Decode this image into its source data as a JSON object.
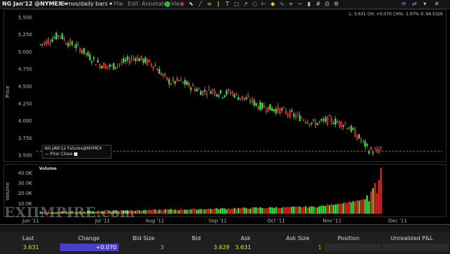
{
  "toolbar": {
    "symbol": "NG Jan'12 @NYMEX",
    "period": "6 mos/daily bars",
    "menus": [
      "File",
      "Edit",
      "Annotate",
      "View"
    ]
  },
  "stats_line": "L: 3.631  CH: +0.070  CH%: 1.97%  V: 94.532K",
  "label_box": {
    "title": "NG JAN'12 Futures@NYMEX",
    "prior_close": "Prior Close"
  },
  "volume_label": "Volume",
  "y_axis_label": "Price",
  "volume_axis_label": "Volume",
  "watermark": "ЕХПМPIRE.com",
  "price_ticks": [
    "5.500",
    "5.250",
    "5.000",
    "4.750",
    "4.500",
    "4.250",
    "4.000",
    "3.750",
    "3.500"
  ],
  "volume_ticks": [
    "40.0K",
    "30.0K",
    "20.0K",
    "10.0K"
  ],
  "x_ticks": [
    "Jun '11",
    "Jul '11",
    "Aug '11",
    "Sep '11",
    "Oct '11",
    "Nov '11",
    "Dec '11"
  ],
  "colors": {
    "up": "#33dd33",
    "down": "#dd2222",
    "change_bg": "#4a3ec9",
    "background": "#000000"
  },
  "quote": {
    "headers": [
      "Last",
      "Change",
      "Bid Size",
      "Bid",
      "Ask",
      "Ask Size",
      "Position",
      "Unrealized P&L"
    ],
    "last": "3.631",
    "change": "+0.070",
    "bid_size": "3",
    "bid": "3.629",
    "ask": "3.631",
    "ask_size": "1"
  },
  "chart_data": {
    "type": "candlestick",
    "ylabel": "Price",
    "ylim": [
      3.45,
      5.55
    ],
    "price_path": [
      [
        0,
        5.1
      ],
      [
        10,
        5.25
      ],
      [
        13,
        5.15
      ],
      [
        20,
        5.05
      ],
      [
        26,
        4.9
      ],
      [
        30,
        4.82
      ],
      [
        36,
        4.78
      ],
      [
        42,
        4.85
      ],
      [
        48,
        4.92
      ],
      [
        52,
        4.88
      ],
      [
        58,
        4.8
      ],
      [
        62,
        4.65
      ],
      [
        66,
        4.55
      ],
      [
        70,
        4.58
      ],
      [
        76,
        4.5
      ],
      [
        82,
        4.42
      ],
      [
        86,
        4.45
      ],
      [
        92,
        4.38
      ],
      [
        96,
        4.42
      ],
      [
        100,
        4.35
      ],
      [
        106,
        4.3
      ],
      [
        110,
        4.22
      ],
      [
        116,
        4.18
      ],
      [
        122,
        4.15
      ],
      [
        128,
        4.08
      ],
      [
        134,
        4.02
      ],
      [
        138,
        3.96
      ],
      [
        142,
        3.98
      ],
      [
        146,
        4.02
      ],
      [
        150,
        3.98
      ],
      [
        154,
        3.95
      ],
      [
        158,
        3.85
      ],
      [
        162,
        3.72
      ],
      [
        166,
        3.58
      ],
      [
        170,
        3.55
      ],
      [
        172,
        3.6
      ]
    ],
    "volume": {
      "ylabel": "Volume",
      "ylim": [
        0,
        45000
      ],
      "last_bars": [
        18000,
        12000,
        22000,
        25000,
        30000,
        20000,
        33000,
        45000
      ]
    }
  }
}
